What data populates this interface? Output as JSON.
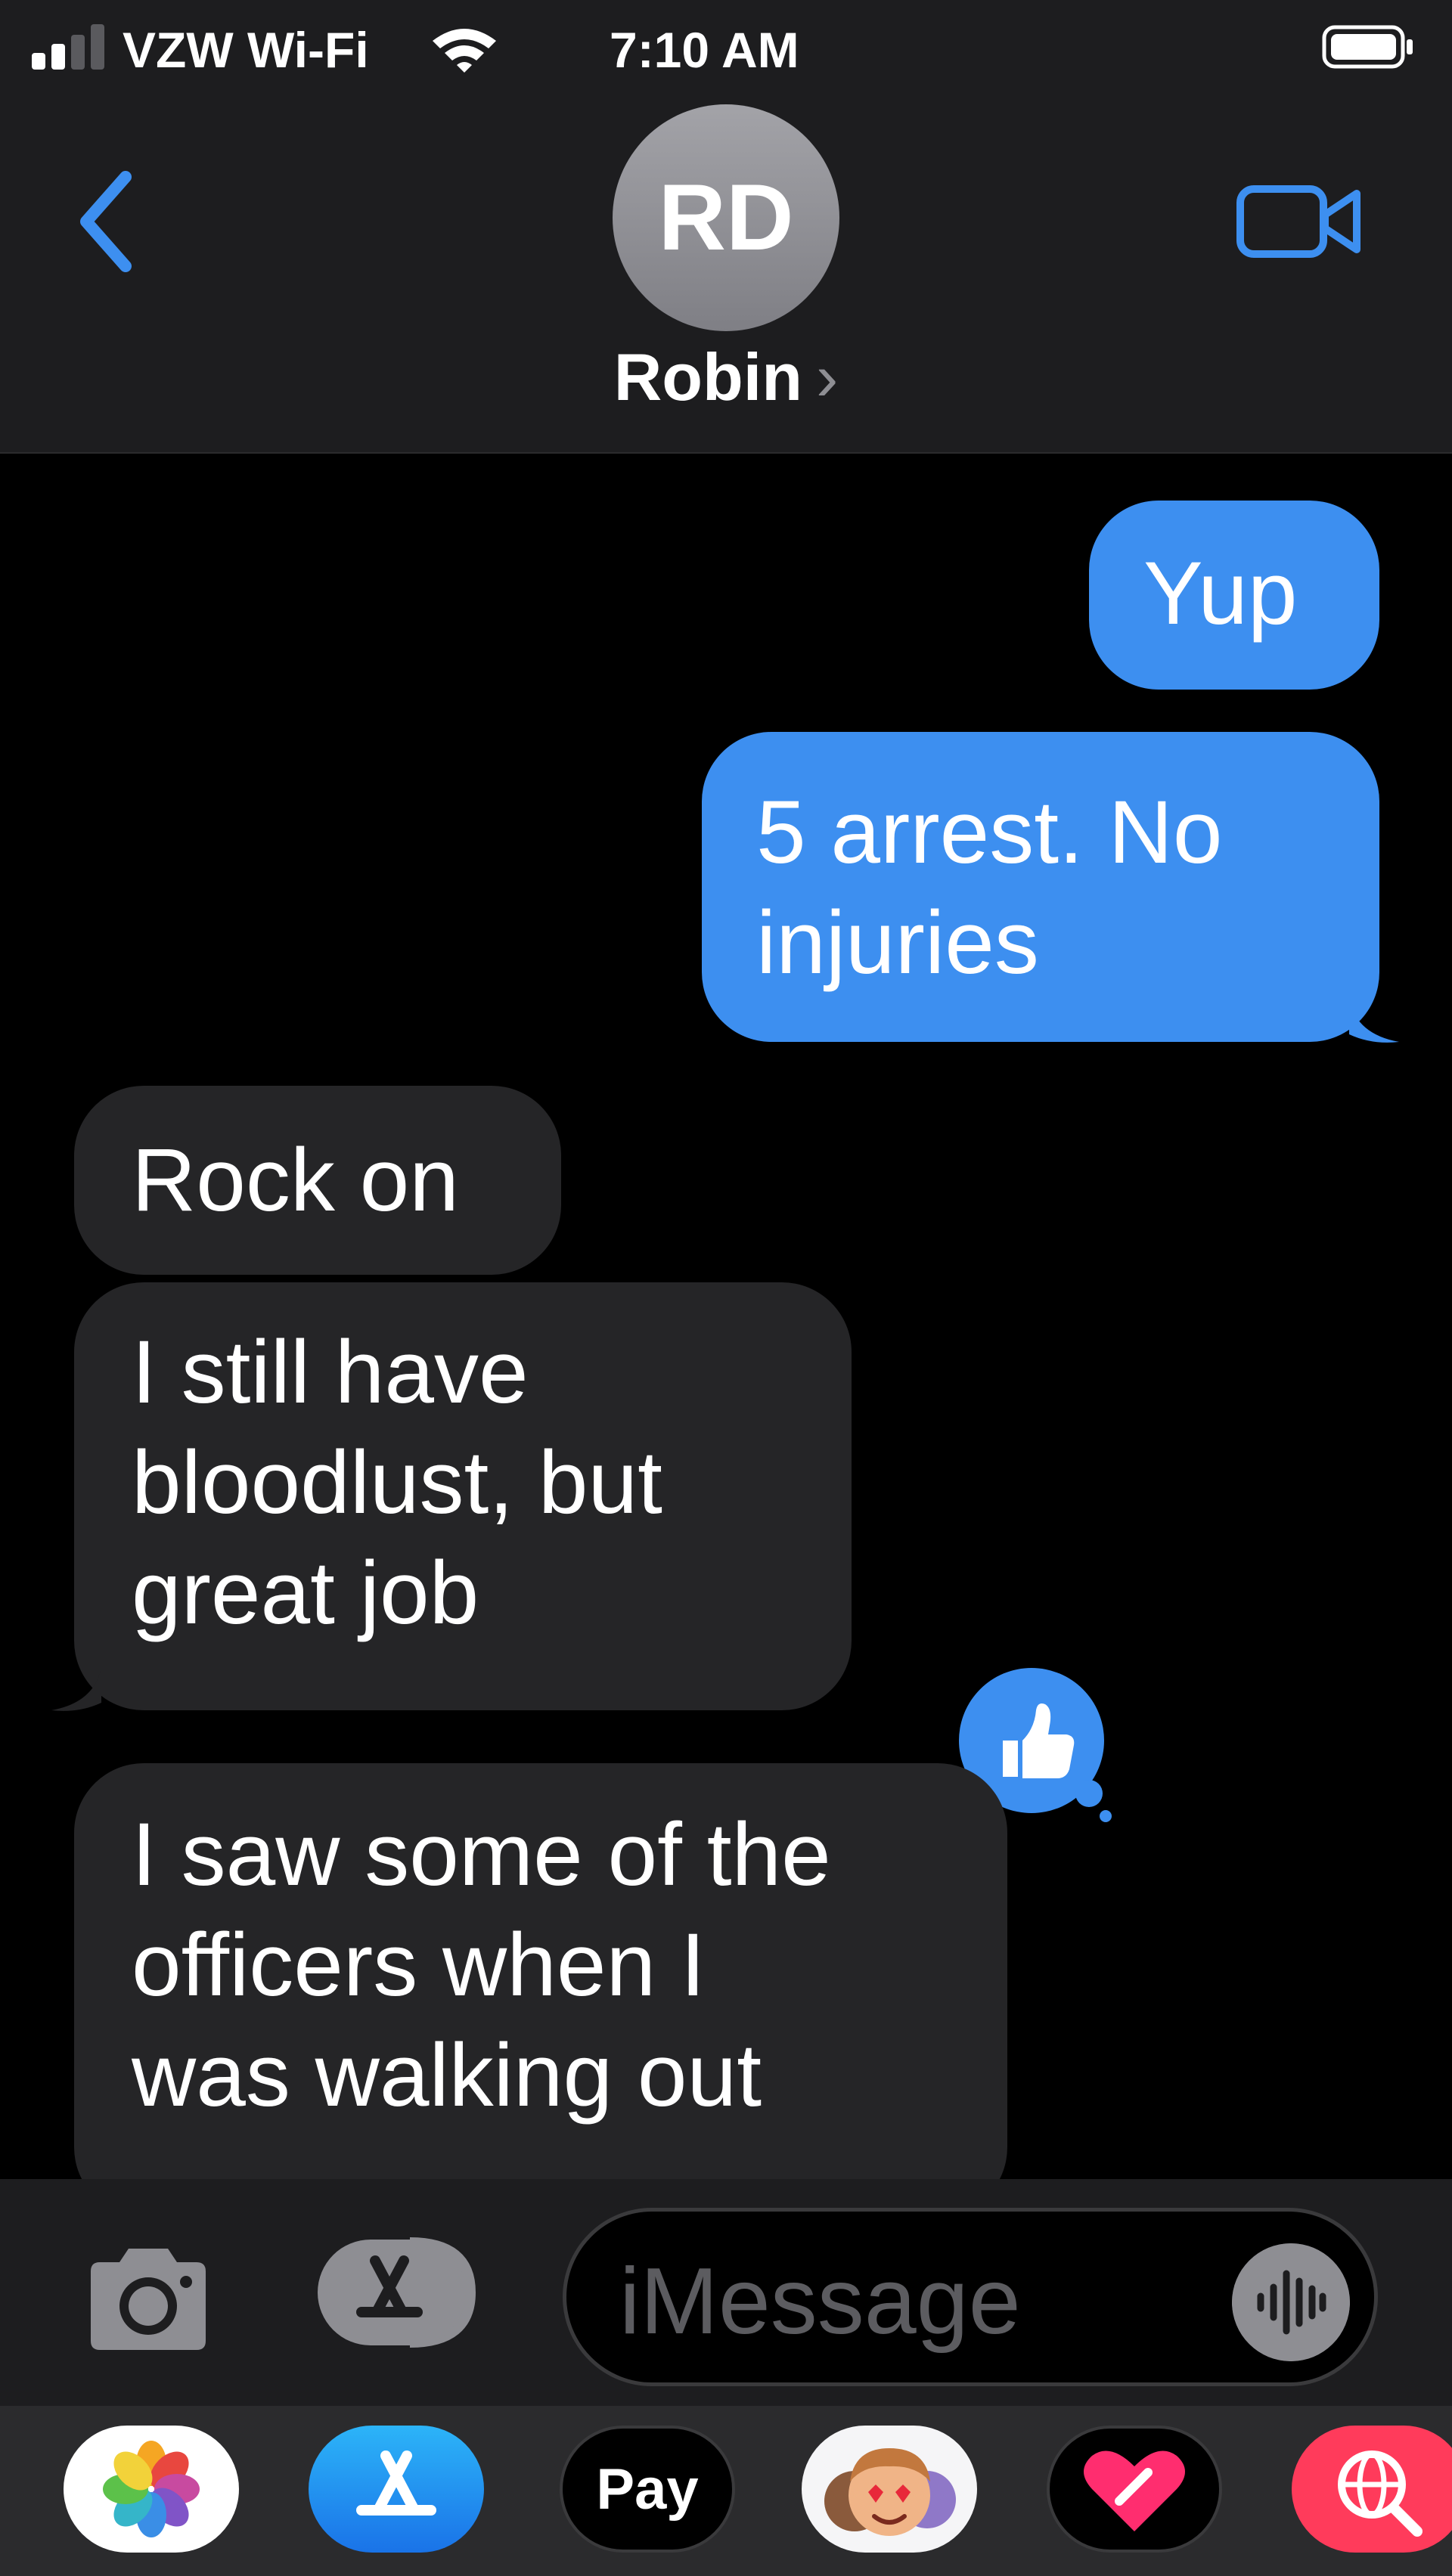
{
  "status_bar": {
    "carrier": "VZW Wi-Fi",
    "time": "7:10 AM",
    "signal_bars": 2,
    "signal_icon": "signal-bars-icon",
    "wifi_icon": "wifi-icon",
    "battery_icon": "battery-icon"
  },
  "header": {
    "back_icon": "chevron-left-icon",
    "avatar_initials": "RD",
    "contact_name": "Robin",
    "contact_chevron": "›",
    "video_icon": "video-camera-icon",
    "accent_color": "#3d8ff0"
  },
  "messages": [
    {
      "direction": "sent",
      "lines": [
        "Yup"
      ]
    },
    {
      "direction": "sent",
      "lines": [
        "5 arrest. No",
        "injuries"
      ]
    },
    {
      "direction": "received",
      "lines": [
        "Rock on"
      ]
    },
    {
      "direction": "received",
      "lines": [
        "I still have",
        "bloodlust, but",
        "great job"
      ],
      "tapback": "thumbs-up-icon"
    },
    {
      "direction": "received",
      "lines": [
        "I saw some of the",
        "officers when I",
        "was walking out"
      ]
    }
  ],
  "colors": {
    "sent_bubble": "#3d8ff0",
    "received_bubble": "#252527",
    "tapback_bubble": "#3d8ff0"
  },
  "composer": {
    "camera_icon": "camera-icon",
    "apps_icon": "app-store-icon",
    "placeholder": "iMessage",
    "audio_icon": "audio-waveform-icon"
  },
  "app_drawer": {
    "apps": [
      "Photos",
      "App Store",
      "Apple Pay",
      "Memoji Stickers",
      "Digital Touch",
      "Image Search"
    ],
    "apple_pay_label": "Pay",
    "apple_glyph": ""
  }
}
